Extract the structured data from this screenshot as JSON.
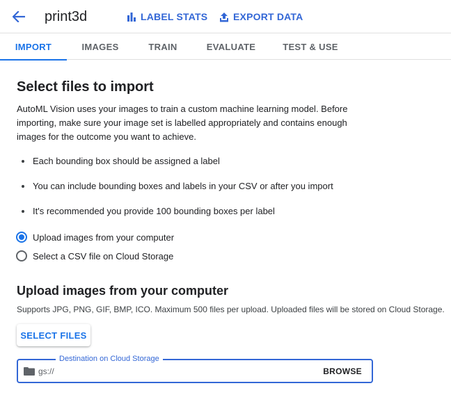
{
  "header": {
    "back_icon": "arrow-back-icon",
    "title": "print3d",
    "label_stats": "LABEL STATS",
    "export_data": "EXPORT DATA",
    "accent": "#3367d6"
  },
  "tabs": [
    {
      "label": "IMPORT",
      "active": true
    },
    {
      "label": "IMAGES",
      "active": false
    },
    {
      "label": "TRAIN",
      "active": false
    },
    {
      "label": "EVALUATE",
      "active": false
    },
    {
      "label": "TEST & USE",
      "active": false
    }
  ],
  "main": {
    "heading": "Select files to import",
    "intro": "AutoML Vision uses your images to train a custom machine learning model. Before importing, make sure your image set is labelled appropriately and contains enough images for the outcome you want to achieve.",
    "bullets": [
      "Each bounding box should be assigned a label",
      "You can include bounding boxes and labels in your CSV or after you import",
      "It's recommended you provide 100 bounding boxes per label"
    ],
    "options": [
      {
        "label": "Upload images from your computer",
        "selected": true
      },
      {
        "label": "Select a CSV file on Cloud Storage",
        "selected": false
      }
    ],
    "upload_heading": "Upload images from your computer",
    "supports": "Supports JPG, PNG, GIF, BMP, ICO. Maximum 500 files per upload. Uploaded files will be stored on Cloud Storage.",
    "select_files": "SELECT FILES",
    "destination": {
      "label": "Destination on Cloud Storage",
      "placeholder": "gs://",
      "browse": "BROWSE",
      "icon": "folder-icon"
    }
  }
}
